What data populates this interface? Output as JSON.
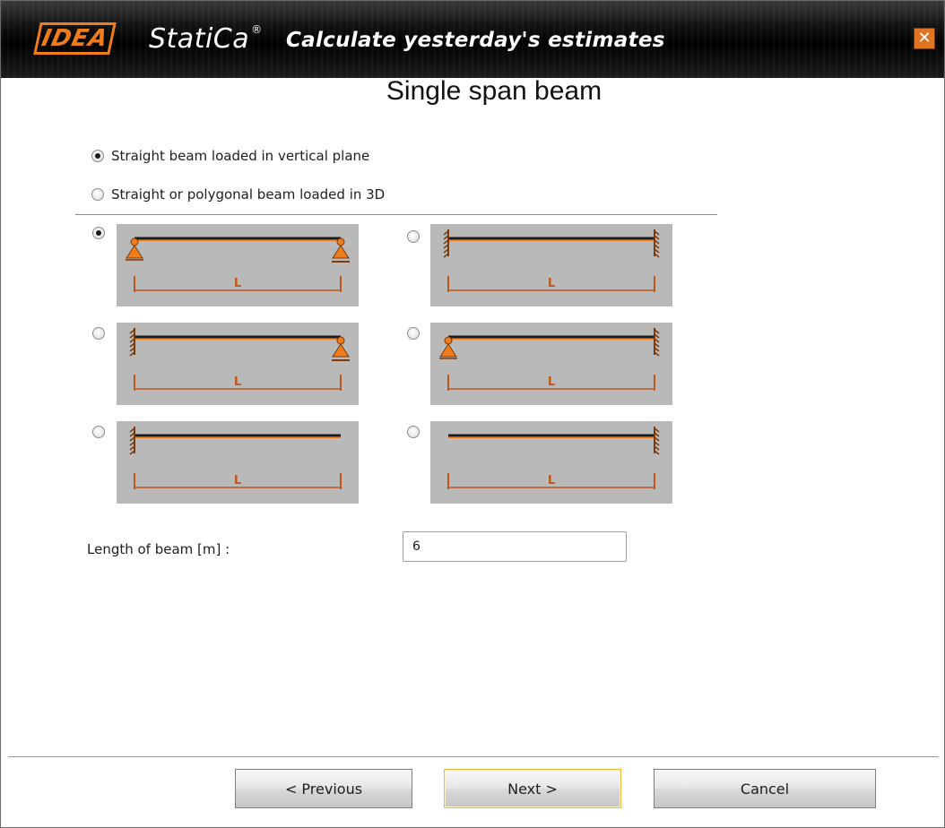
{
  "header": {
    "logo_idea": "IDEA",
    "logo_statica": "StatiCa",
    "logo_registered": "®",
    "slogan": "Calculate yesterday's estimates",
    "close_label": "✕"
  },
  "title": "Single span beam",
  "beam_mode_options": [
    {
      "label": "Straight beam loaded in vertical plane",
      "checked": true
    },
    {
      "label": "Straight or polygonal beam loaded in 3D",
      "checked": false
    }
  ],
  "beam_types": [
    {
      "id": "pinned-pinned",
      "left_support": "pin",
      "right_support": "roller",
      "span_label": "L",
      "checked": true
    },
    {
      "id": "fixed-fixed",
      "left_support": "fixed",
      "right_support": "fixed",
      "span_label": "L",
      "checked": false
    },
    {
      "id": "fixed-pinned",
      "left_support": "fixed",
      "right_support": "roller",
      "span_label": "L",
      "checked": false
    },
    {
      "id": "pinned-fixed",
      "left_support": "pin",
      "right_support": "fixed",
      "span_label": "L",
      "checked": false
    },
    {
      "id": "fixed-free",
      "left_support": "fixed",
      "right_support": "free",
      "span_label": "L",
      "checked": false
    },
    {
      "id": "free-fixed",
      "left_support": "free",
      "right_support": "fixed",
      "span_label": "L",
      "checked": false
    }
  ],
  "length": {
    "label": "Length of beam [m] :",
    "value": "6"
  },
  "buttons": {
    "previous": "< Previous",
    "next": "Next >",
    "cancel": "Cancel"
  },
  "colors": {
    "accent": "#f07d1a",
    "diagram_bg": "#b9b9b9",
    "beam": "#1a1a1a",
    "dimension": "#c0561a"
  }
}
